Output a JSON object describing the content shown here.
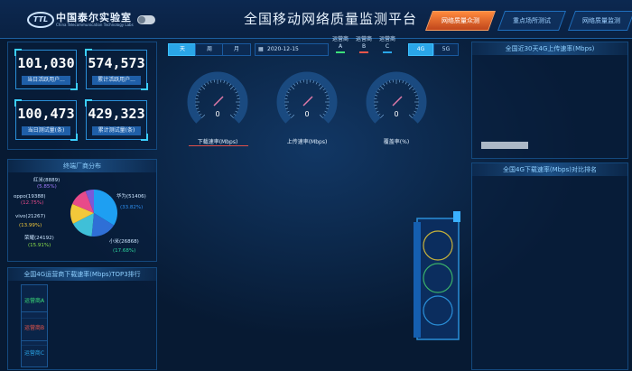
{
  "header": {
    "logo_badge": "TTL",
    "logo_cn": "中国泰尔实验室",
    "logo_en": "China Telecommunication Technology Labs",
    "title": "全国移动网络质量监测平台",
    "tabs": [
      {
        "label": "网络质量众测",
        "active": true
      },
      {
        "label": "重点场所测试",
        "active": false
      },
      {
        "label": "网络质量监测",
        "active": false
      }
    ]
  },
  "stats": [
    {
      "value": "101,030",
      "label": "当日活跃用户..."
    },
    {
      "value": "574,573",
      "label": "累计活跃用户..."
    },
    {
      "value": "100,473",
      "label": "当日测试量(条)"
    },
    {
      "value": "429,323",
      "label": "累计测试量(条)"
    }
  ],
  "vendor_panel": {
    "title": "终端厂商分布",
    "slices": [
      {
        "name": "华为",
        "count": "51406",
        "pct": "33.82%",
        "value": 33.82,
        "color": "#1e9ff2",
        "pct_color": "#2d8ff0"
      },
      {
        "name": "小米",
        "count": "26868",
        "pct": "17.68%",
        "value": 17.68,
        "color": "#2f6fd6",
        "pct_color": "#2dd6a0"
      },
      {
        "name": "荣耀",
        "count": "24192",
        "pct": "15.91%",
        "value": 15.91,
        "color": "#3fc0d8",
        "pct_color": "#8de04a"
      },
      {
        "name": "vivo",
        "count": "21267",
        "pct": "13.99%",
        "value": 13.99,
        "color": "#f2c83a",
        "pct_color": "#f2c83a"
      },
      {
        "name": "oppo",
        "count": "19388",
        "pct": "12.75%",
        "value": 12.75,
        "color": "#e84a8a",
        "pct_color": "#e84a8a"
      },
      {
        "name": "红米",
        "count": "8889",
        "pct": "5.85%",
        "value": 5.85,
        "color": "#7a5ad8",
        "pct_color": "#a27bff"
      }
    ]
  },
  "top3_panel": {
    "title": "全国4G运营商下载速率(Mbps)TOP3排行",
    "items": [
      {
        "label": "运营商A",
        "color": "#3ce07a"
      },
      {
        "label": "运营商B",
        "color": "#f0564a"
      },
      {
        "label": "运营商C",
        "color": "#2aa6e8"
      }
    ]
  },
  "filters": {
    "periods": [
      {
        "label": "天",
        "active": true
      },
      {
        "label": "周",
        "active": false
      },
      {
        "label": "月",
        "active": false
      }
    ],
    "date": "2020-12-15",
    "operators": [
      {
        "label": "运营商A",
        "color": "#3ce07a"
      },
      {
        "label": "运营商B",
        "color": "#f0564a"
      },
      {
        "label": "运营商C",
        "color": "#2aa6e8"
      }
    ],
    "networks": [
      {
        "label": "4G",
        "active": true
      },
      {
        "label": "5G",
        "active": false
      }
    ]
  },
  "gauges": [
    {
      "value": "0",
      "label": "下载速率(Mbps)"
    },
    {
      "value": "0",
      "label": "上传速率(Mbps)"
    },
    {
      "value": "0",
      "label": "覆盖率(%)"
    }
  ],
  "right_panels": {
    "upload_title": "全国近30天4G上传速率(Mbps)",
    "download_title": "全国4G下载速率(Mbps)对比排名"
  }
}
